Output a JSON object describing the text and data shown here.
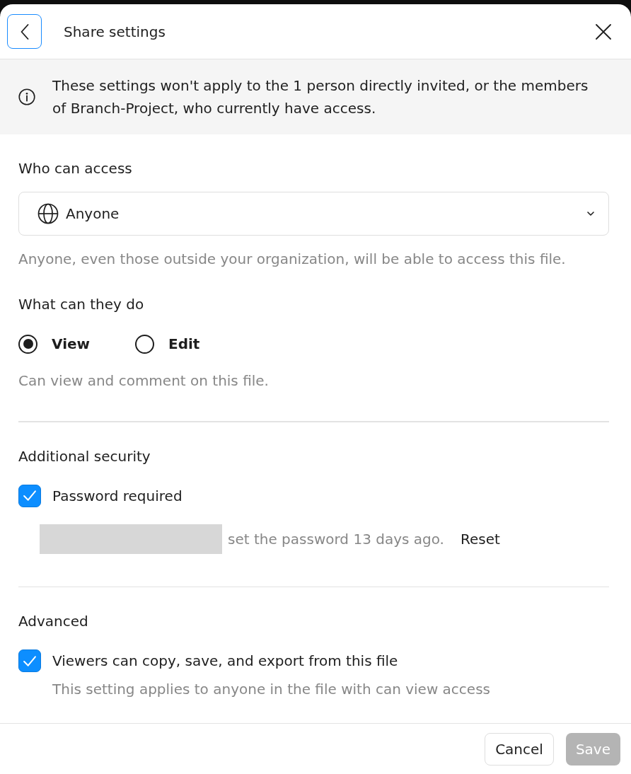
{
  "header": {
    "title": "Share settings"
  },
  "notice": {
    "text": "These settings won't apply to the 1 person directly invited, or the members of Branch-Project, who currently have access."
  },
  "access": {
    "heading": "Who can access",
    "select": {
      "value": "Anyone"
    },
    "description": "Anyone, even those outside your organization, will be able to access this file."
  },
  "permissions": {
    "heading": "What can they do",
    "options": [
      {
        "label": "View",
        "selected": true
      },
      {
        "label": "Edit",
        "selected": false
      }
    ],
    "description": "Can view and comment on this file."
  },
  "security": {
    "heading": "Additional security",
    "password_required": {
      "label": "Password required",
      "checked": true
    },
    "status": "set the password 13 days ago.",
    "reset_link": "Reset"
  },
  "advanced": {
    "heading": "Advanced",
    "options": [
      {
        "label": "Viewers can copy, save, and export from this file",
        "checked": true,
        "description": "This setting applies to anyone in the file with can view access"
      }
    ]
  },
  "footer": {
    "buttons": [
      {
        "label": "Cancel",
        "kind": "secondary",
        "disabled": false
      },
      {
        "label": "Save",
        "kind": "primary",
        "disabled": true
      }
    ]
  }
}
